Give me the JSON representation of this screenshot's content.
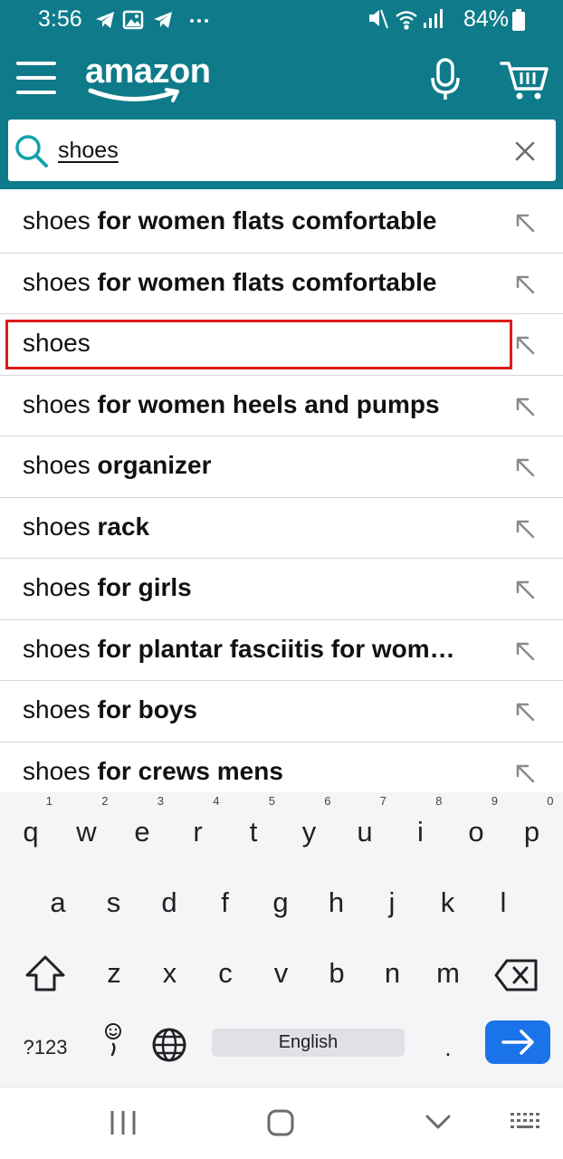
{
  "status_bar": {
    "time": "3:56",
    "battery": "84%",
    "left_icons": [
      "telegram-icon",
      "image-icon",
      "telegram-icon",
      "more-dots-icon"
    ],
    "right_icons": [
      "mute-icon",
      "wifi-icon",
      "signal-icon",
      "battery-icon"
    ]
  },
  "header": {
    "brand": "amazon",
    "menu_icon": "hamburger-menu-icon",
    "mic_icon": "microphone-icon",
    "cart_icon": "cart-icon",
    "color": "#0f7b8a"
  },
  "search": {
    "value": "shoes",
    "icon": "search-icon",
    "clear_icon": "close-icon"
  },
  "suggestions": [
    {
      "prefix": "shoes",
      "suffix": " for women flats comfortable"
    },
    {
      "prefix": "shoes",
      "suffix": " for women flats comfortable"
    },
    {
      "prefix": "shoes",
      "suffix": ""
    },
    {
      "prefix": "shoes",
      "suffix": " for women heels and pumps"
    },
    {
      "prefix": "shoes",
      "suffix": " organizer"
    },
    {
      "prefix": "shoes",
      "suffix": " rack"
    },
    {
      "prefix": "shoes",
      "suffix": " for girls"
    },
    {
      "prefix": "shoes",
      "suffix": " for plantar fasciitis for wom…"
    },
    {
      "prefix": "shoes",
      "suffix": " for boys"
    },
    {
      "prefix": "shoes",
      "suffix": " for crews mens"
    }
  ],
  "highlighted_suggestion_index": 2,
  "keyboard": {
    "row1": [
      {
        "key": "q",
        "hint": "1"
      },
      {
        "key": "w",
        "hint": "2"
      },
      {
        "key": "e",
        "hint": "3"
      },
      {
        "key": "r",
        "hint": "4"
      },
      {
        "key": "t",
        "hint": "5"
      },
      {
        "key": "y",
        "hint": "6"
      },
      {
        "key": "u",
        "hint": "7"
      },
      {
        "key": "i",
        "hint": "8"
      },
      {
        "key": "o",
        "hint": "9"
      },
      {
        "key": "p",
        "hint": "0"
      }
    ],
    "row2": [
      "a",
      "s",
      "d",
      "f",
      "g",
      "h",
      "j",
      "k",
      "l"
    ],
    "row3": [
      "z",
      "x",
      "c",
      "v",
      "b",
      "n",
      "m"
    ],
    "symbols_label": "?123",
    "space_label": "English",
    "period_label": ".",
    "accent_color": "#1a73e8"
  },
  "navbar": {
    "icons": [
      "recent-apps-icon",
      "home-icon",
      "back-icon",
      "keyboard-switch-icon"
    ]
  }
}
